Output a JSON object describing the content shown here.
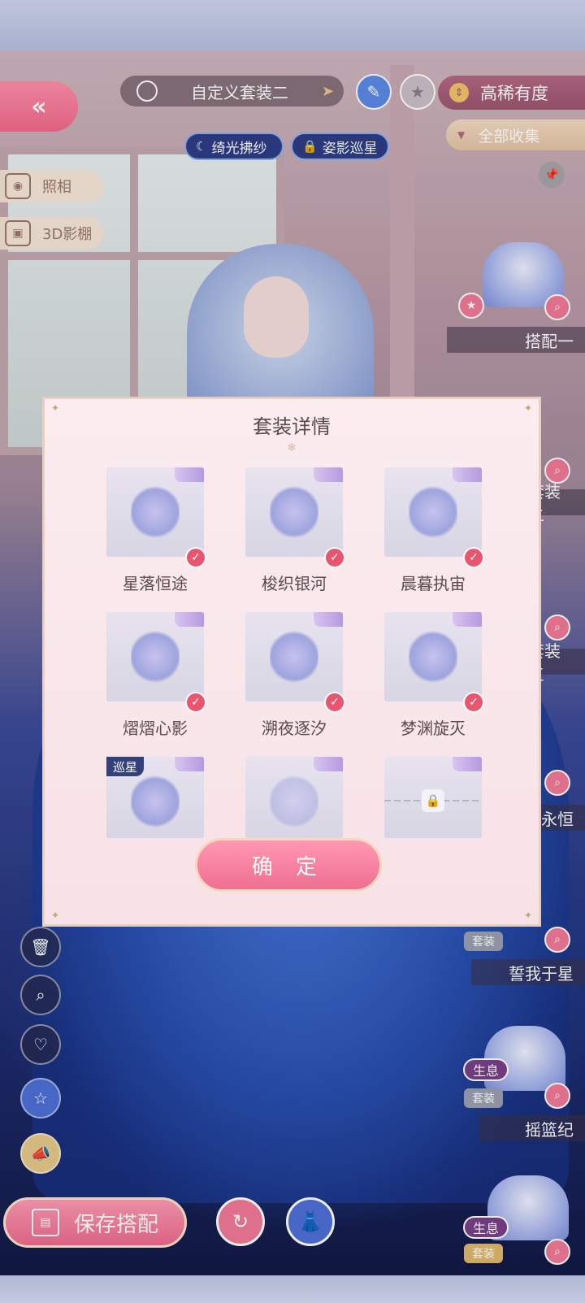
{
  "header": {
    "back_icon": "double-chevron-left",
    "outfit_name": "自定义套装二",
    "rarity_label": "高稀有度",
    "collect_label": "全部收集",
    "tags": [
      {
        "label": "绮光拂纱",
        "icon": "moon-icon"
      },
      {
        "label": "姿影巡星",
        "icon": "lock-icon"
      }
    ]
  },
  "side_buttons": {
    "photo": "照相",
    "studio3d": "3D影棚"
  },
  "right_panel": {
    "cards": [
      {
        "label": "搭配一"
      },
      {
        "label": "套装二"
      },
      {
        "label": "套装三"
      },
      {
        "label": "永恒"
      },
      {
        "label": "誓我于星",
        "badge": "套装"
      },
      {
        "label": "摇篮纪",
        "badge": "套装",
        "tag": "生息"
      },
      {
        "label": "",
        "badge": "套装",
        "tag": "生息"
      }
    ]
  },
  "modal": {
    "title": "套装详情",
    "items": [
      {
        "name": "星落恒途",
        "owned": true
      },
      {
        "name": "梭织银河",
        "owned": true
      },
      {
        "name": "晨暮执宙",
        "owned": true
      },
      {
        "name": "熠熠心影",
        "owned": true
      },
      {
        "name": "溯夜逐汐",
        "owned": true
      },
      {
        "name": "梦渊旋灭",
        "owned": true
      },
      {
        "name": "",
        "owned": false,
        "tag": "巡星"
      },
      {
        "name": "",
        "owned": false
      },
      {
        "name": "",
        "owned": false,
        "locked": true
      }
    ],
    "confirm_label": "确 定"
  },
  "bottom": {
    "save_label": "保存搭配"
  },
  "colors": {
    "accent_pink": "#ef6f90",
    "check_red": "#e8556f",
    "gold": "#e0b86c"
  }
}
